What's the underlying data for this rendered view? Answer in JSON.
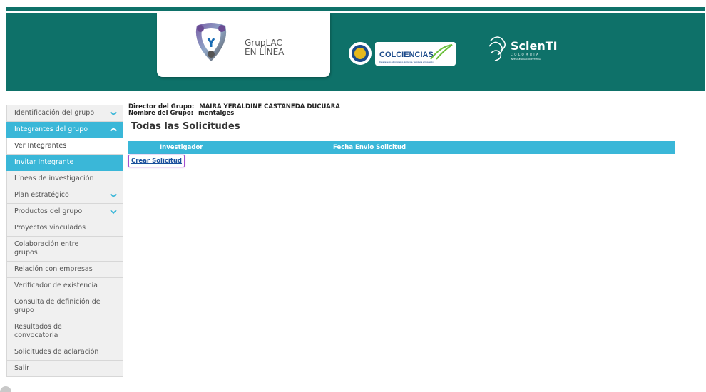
{
  "header": {
    "logo_line1": "GrupLAC",
    "logo_line2": "EN LÍNEA",
    "colciencias_label": "COLCIENCIAS",
    "colciencias_sub": "Departamento Administrativo de Ciencia, Tecnología e Innovación",
    "scienti_label": "ScienTI",
    "scienti_sub": "COLOMBIA",
    "scienti_tag": "INTELIGENCIA COMPETITIVA"
  },
  "sidebar": {
    "items": [
      {
        "label": "Identificación del grupo"
      },
      {
        "label": "Integrantes del grupo"
      },
      {
        "label": "Ver Integrantes"
      },
      {
        "label": "Invitar Integrante"
      },
      {
        "label": "Líneas de investigación"
      },
      {
        "label": "Plan estratégico"
      },
      {
        "label": "Productos del grupo"
      },
      {
        "label": "Proyectos vinculados"
      },
      {
        "label": "Colaboración entre grupos"
      },
      {
        "label": "Relación con empresas"
      },
      {
        "label": "Verificador de existencia"
      },
      {
        "label": "Consulta de definición de grupo"
      },
      {
        "label": "Resultados de convocatoria"
      },
      {
        "label": "Solicitudes de aclaración"
      },
      {
        "label": "Salir"
      }
    ]
  },
  "main": {
    "director_label": "Director del Grupo:",
    "director_value": "MAIRA YERALDINE CASTANEDA DUCUARA",
    "group_label": "Nombre del Grupo:",
    "group_value": "mentalges",
    "title": "Todas las Solicitudes",
    "columns": [
      "Investigador",
      "Fecha Envio Solicitud"
    ],
    "create_link": "Crear Solicitud"
  },
  "colors": {
    "header_bg": "#0e7169",
    "accent": "#3ab7d8",
    "focus_outline": "#a24fcf"
  }
}
